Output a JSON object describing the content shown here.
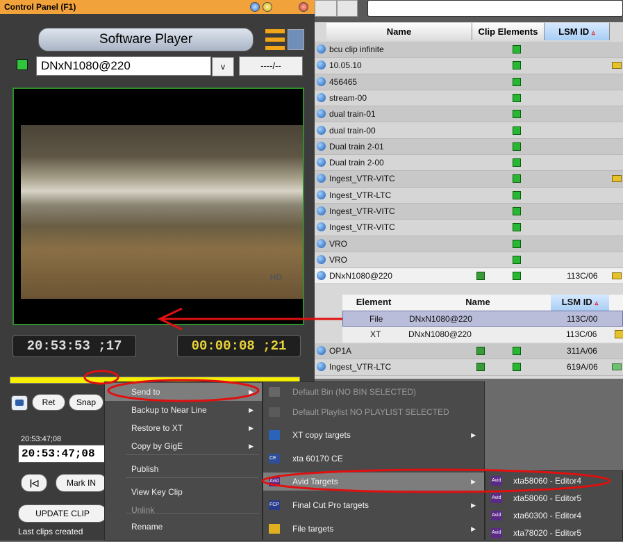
{
  "control_panel": {
    "title": "Control Panel (F1)",
    "player_button": "Software Player",
    "clip_name": "DNxN1080@220",
    "dropdown_button": "v",
    "timecode_button": "----/--",
    "viewer_overlay": "HD",
    "current_timecode": "20:53:53 ;17",
    "duration_timecode": "00:00:08 ;21",
    "buttons": {
      "ret": "Ret",
      "snap": "Snap",
      "mark_in": "Mark IN",
      "update_clip": "UPDATE CLIP"
    },
    "tc_in_label": "20:53:47;08",
    "tc_in_value": "20:53:47;08",
    "last_clips_label": "Last clips created",
    "colors": {
      "title_bar": "#f2a23a",
      "timebar": "#f6f000",
      "viewer_border": "#2c8f2c"
    }
  },
  "clip_table": {
    "columns": {
      "name": "Name",
      "clip_elements": "Clip Elements",
      "lsm_id": "LSM ID"
    },
    "rows": [
      {
        "name": "bcu clip infinite"
      },
      {
        "name": "10.05.10"
      },
      {
        "name": "456465"
      },
      {
        "name": "stream-00"
      },
      {
        "name": "dual train-01"
      },
      {
        "name": "dual train-00"
      },
      {
        "name": "Dual train 2-01"
      },
      {
        "name": "Dual train 2-00"
      },
      {
        "name": "Ingest_VTR-VITC"
      },
      {
        "name": "Ingest_VTR-LTC"
      },
      {
        "name": "Ingest_VTR-VITC"
      },
      {
        "name": "Ingest_VTR-VITC"
      },
      {
        "name": "VRO"
      },
      {
        "name": "VRO"
      },
      {
        "name": "DNxN1080@220",
        "lsm": "113C/06"
      }
    ],
    "sub_table": {
      "columns": {
        "element": "Element",
        "name": "Name",
        "lsm_id": "LSM ID"
      },
      "rows": [
        {
          "element": "File",
          "name": "DNxN1080@220",
          "lsm": "113C/00"
        },
        {
          "element": "XT",
          "name": "DNxN1080@220",
          "lsm": "113C/06"
        }
      ]
    },
    "after_rows": [
      {
        "name": "OP1A",
        "lsm": "311A/06"
      },
      {
        "name": "Ingest_VTR-LTC",
        "lsm": "619A/06"
      }
    ]
  },
  "context_menu": {
    "items": [
      "Send to",
      "Backup to Near Line",
      "Restore to XT",
      "Copy by GigE",
      "Publish",
      "View Key Clip",
      "Unlink",
      "Rename"
    ]
  },
  "send_to_menu": {
    "items": [
      "Default Bin (NO BIN SELECTED)",
      "Default Playlist NO PLAYLIST SELECTED",
      "XT copy targets",
      "xta 60170 CE",
      "Avid Targets",
      "Final Cut Pro targets",
      "File targets"
    ],
    "icon_labels": {
      "ce": "CE",
      "avid": "Avid",
      "fcp": "FCP"
    }
  },
  "avid_menu": {
    "items": [
      "xta58060 - Editor4",
      "xta58060 - Editor5",
      "xta60300 - Editor4",
      "xta78020 - Editor5"
    ]
  }
}
